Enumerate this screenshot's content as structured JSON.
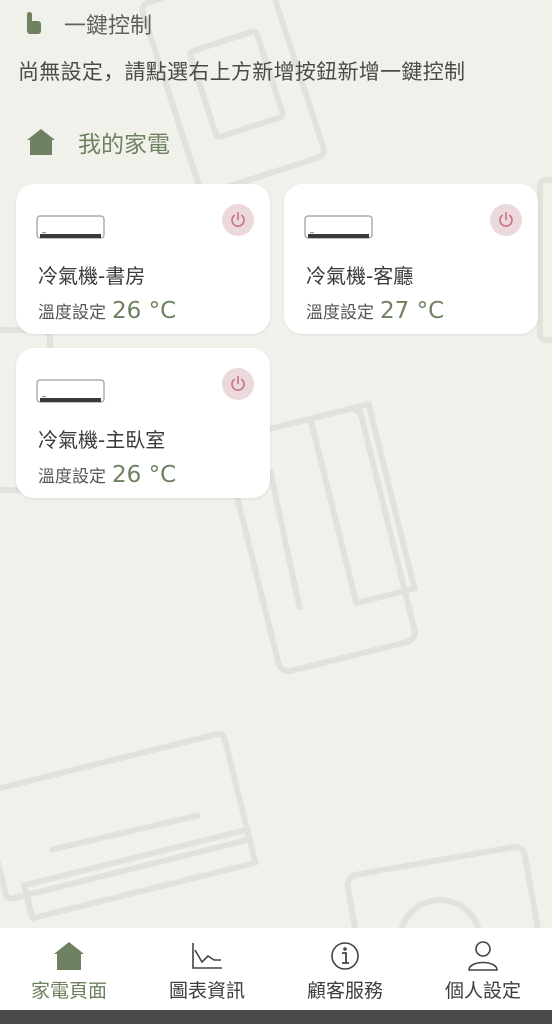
{
  "one_click": {
    "title": "一鍵控制",
    "hint": "尚無設定，請點選右上方新增按鈕新增一鍵控制",
    "icon": "hand-pointer-icon"
  },
  "appliances": {
    "title": "我的家電",
    "icon": "house-icon",
    "temp_label": "溫度設定",
    "items": [
      {
        "name": "冷氣機-書房",
        "temp": "26 °C",
        "power_on": false
      },
      {
        "name": "冷氣機-客廳",
        "temp": "27 °C",
        "power_on": false
      },
      {
        "name": "冷氣機-主臥室",
        "temp": "26 °C",
        "power_on": false
      }
    ]
  },
  "nav": {
    "items": [
      {
        "label": "家電頁面",
        "icon": "house-icon",
        "active": true
      },
      {
        "label": "圖表資訊",
        "icon": "chart-icon",
        "active": false
      },
      {
        "label": "顧客服務",
        "icon": "info-icon",
        "active": false
      },
      {
        "label": "個人設定",
        "icon": "person-icon",
        "active": false
      }
    ]
  },
  "colors": {
    "accent": "#6e8160",
    "background": "#f1f1ec",
    "power_button": "#ecd9dc",
    "power_icon": "#c9707f"
  }
}
